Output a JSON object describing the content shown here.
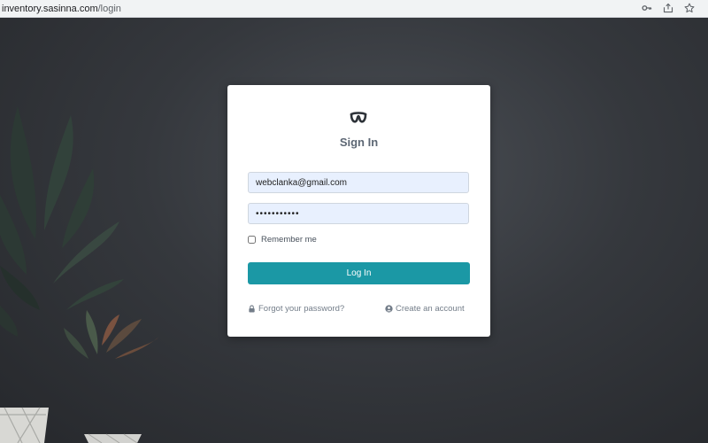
{
  "browser": {
    "url_host": "inventory.sasinna.com",
    "url_path": "/login",
    "icons": [
      "key-icon",
      "share-icon",
      "star-icon"
    ]
  },
  "login": {
    "title": "Sign In",
    "email_value": "webclanka@gmail.com",
    "password_value": "•••••••••••",
    "remember_label": "Remember me",
    "remember_checked": false,
    "submit_label": "Log In",
    "forgot_label": "Forgot your password?",
    "create_label": "Create an account"
  },
  "colors": {
    "primary_button": "#1b98a5",
    "input_background": "#e8f0fe",
    "title_text": "#5d6774",
    "link_text": "#737d89"
  }
}
